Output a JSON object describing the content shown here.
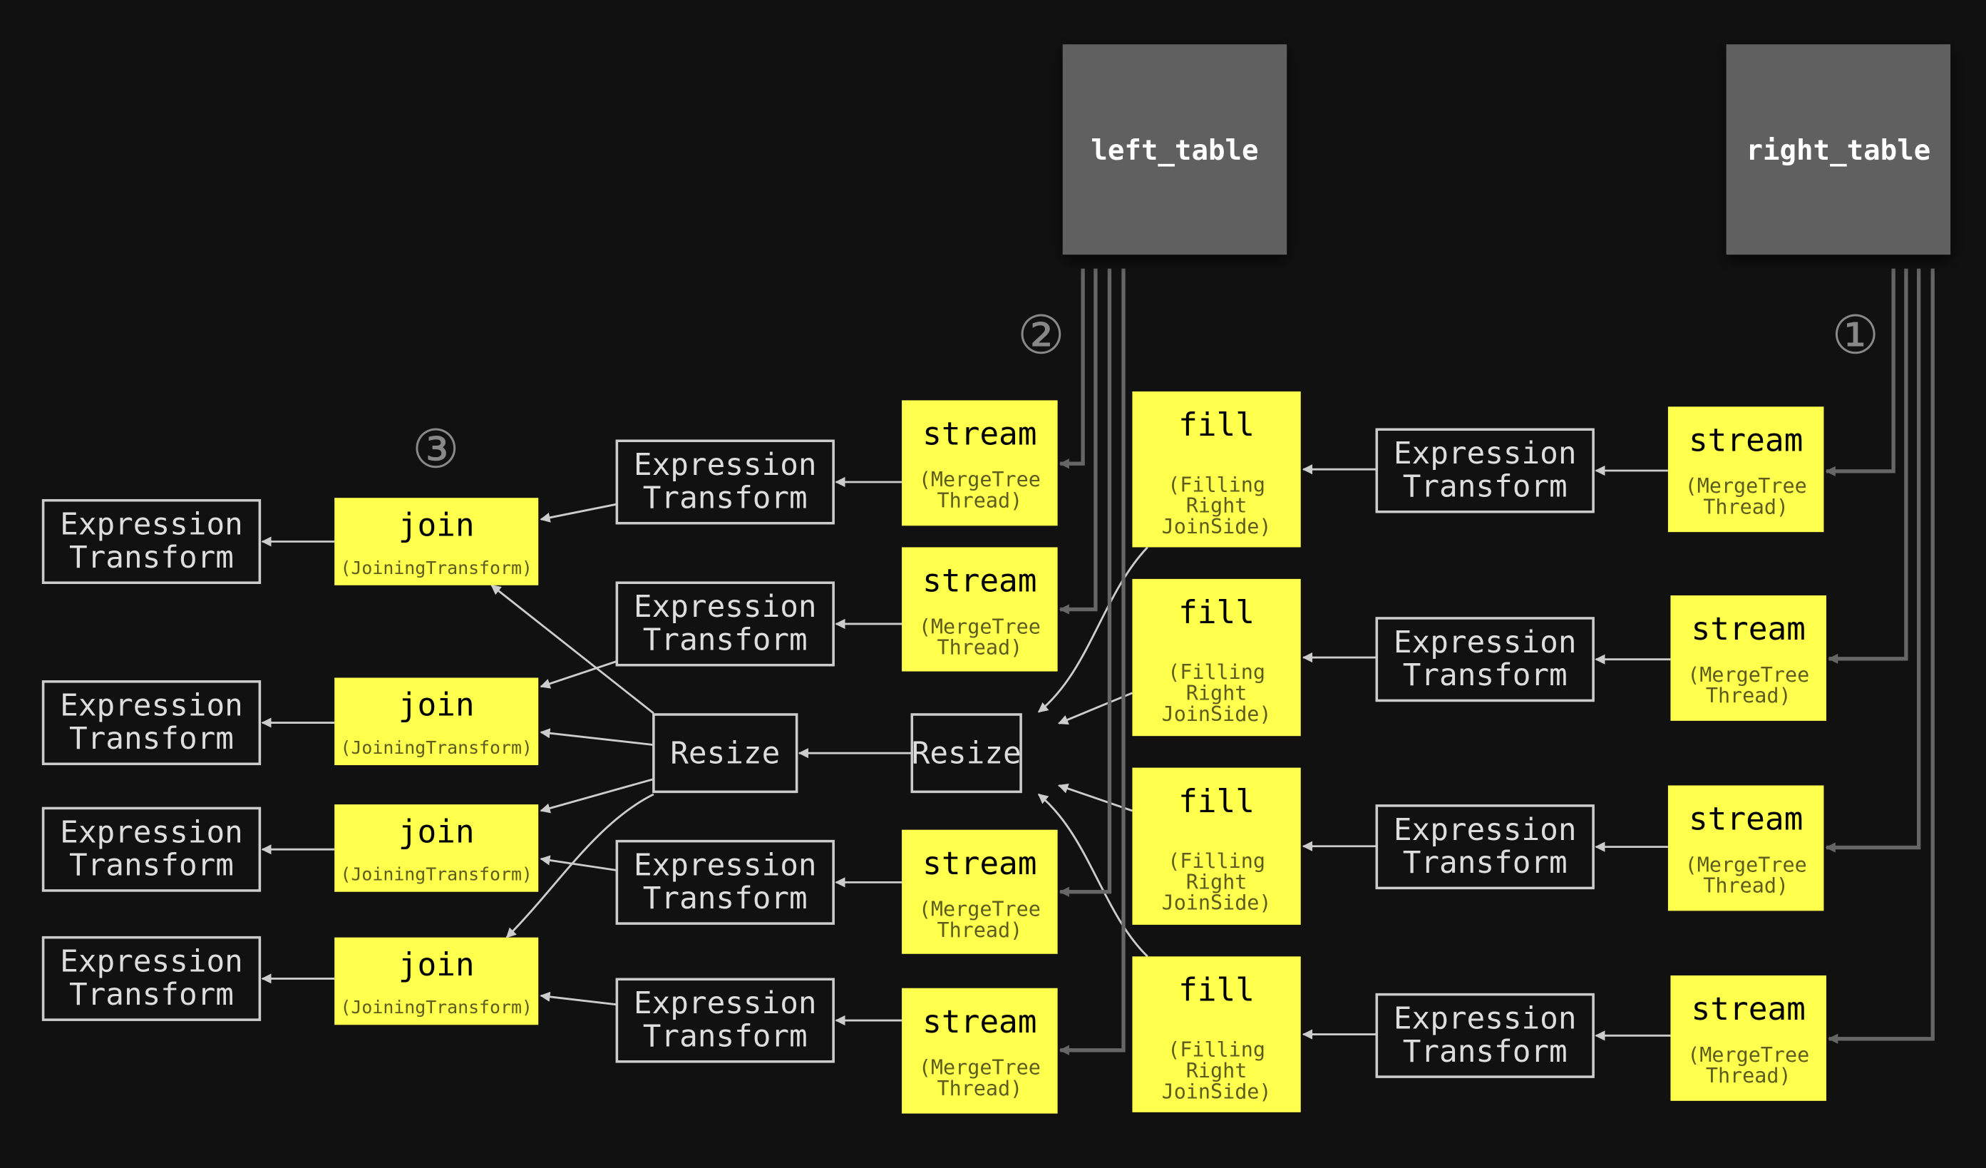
{
  "colors": {
    "background": "#111111",
    "table": "#606060",
    "processor": "#ffff4d",
    "edge": "#cccccc",
    "table_edge": "#666666"
  },
  "tables": [
    {
      "id": "lt",
      "label": "left_table"
    },
    {
      "id": "rt",
      "label": "right_table"
    }
  ],
  "markers": [
    {
      "id": "m2",
      "label": "②"
    },
    {
      "id": "m1",
      "label": "①"
    },
    {
      "id": "m3",
      "label": "③"
    }
  ],
  "nodes": [
    {
      "id": "rs1",
      "kind": "yellow",
      "title": "stream",
      "sub": [
        "(MergeTree",
        "Thread)"
      ]
    },
    {
      "id": "rs2",
      "kind": "yellow",
      "title": "stream",
      "sub": [
        "(MergeTree",
        "Thread)"
      ]
    },
    {
      "id": "rs3",
      "kind": "yellow",
      "title": "stream",
      "sub": [
        "(MergeTree",
        "Thread)"
      ]
    },
    {
      "id": "rs4",
      "kind": "yellow",
      "title": "stream",
      "sub": [
        "(MergeTree",
        "Thread)"
      ]
    },
    {
      "id": "re1",
      "kind": "box",
      "title": "Expression",
      "title2": "Transform"
    },
    {
      "id": "re2",
      "kind": "box",
      "title": "Expression",
      "title2": "Transform"
    },
    {
      "id": "re3",
      "kind": "box",
      "title": "Expression",
      "title2": "Transform"
    },
    {
      "id": "re4",
      "kind": "box",
      "title": "Expression",
      "title2": "Transform"
    },
    {
      "id": "f1",
      "kind": "yellow",
      "title": "fill",
      "sub": [
        "(Filling",
        "Right",
        "JoinSide)"
      ]
    },
    {
      "id": "f2",
      "kind": "yellow",
      "title": "fill",
      "sub": [
        "(Filling",
        "Right",
        "JoinSide)"
      ]
    },
    {
      "id": "f3",
      "kind": "yellow",
      "title": "fill",
      "sub": [
        "(Filling",
        "Right",
        "JoinSide)"
      ]
    },
    {
      "id": "f4",
      "kind": "yellow",
      "title": "fill",
      "sub": [
        "(Filling",
        "Right",
        "JoinSide)"
      ]
    },
    {
      "id": "rz2",
      "kind": "box",
      "title": "Resize"
    },
    {
      "id": "rz1",
      "kind": "box",
      "title": "Resize"
    },
    {
      "id": "ls1",
      "kind": "yellow",
      "title": "stream",
      "sub": [
        "(MergeTree",
        "Thread)"
      ]
    },
    {
      "id": "ls2",
      "kind": "yellow",
      "title": "stream",
      "sub": [
        "(MergeTree",
        "Thread)"
      ]
    },
    {
      "id": "ls3",
      "kind": "yellow",
      "title": "stream",
      "sub": [
        "(MergeTree",
        "Thread)"
      ]
    },
    {
      "id": "ls4",
      "kind": "yellow",
      "title": "stream",
      "sub": [
        "(MergeTree",
        "Thread)"
      ]
    },
    {
      "id": "me1",
      "kind": "box",
      "title": "Expression",
      "title2": "Transform"
    },
    {
      "id": "me2",
      "kind": "box",
      "title": "Expression",
      "title2": "Transform"
    },
    {
      "id": "me3",
      "kind": "box",
      "title": "Expression",
      "title2": "Transform"
    },
    {
      "id": "me4",
      "kind": "box",
      "title": "Expression",
      "title2": "Transform"
    },
    {
      "id": "j1",
      "kind": "yellow",
      "title": "join",
      "sub": [
        "(JoiningTransform)"
      ]
    },
    {
      "id": "j2",
      "kind": "yellow",
      "title": "join",
      "sub": [
        "(JoiningTransform)"
      ]
    },
    {
      "id": "j3",
      "kind": "yellow",
      "title": "join",
      "sub": [
        "(JoiningTransform)"
      ]
    },
    {
      "id": "j4",
      "kind": "yellow",
      "title": "join",
      "sub": [
        "(JoiningTransform)"
      ]
    },
    {
      "id": "le1",
      "kind": "box",
      "title": "Expression",
      "title2": "Transform"
    },
    {
      "id": "le2",
      "kind": "box",
      "title": "Expression",
      "title2": "Transform"
    },
    {
      "id": "le3",
      "kind": "box",
      "title": "Expression",
      "title2": "Transform"
    },
    {
      "id": "le4",
      "kind": "box",
      "title": "Expression",
      "title2": "Transform"
    }
  ],
  "edges": [
    [
      "rt",
      "rs1"
    ],
    [
      "rt",
      "rs2"
    ],
    [
      "rt",
      "rs3"
    ],
    [
      "rt",
      "rs4"
    ],
    [
      "rs1",
      "re1"
    ],
    [
      "rs2",
      "re2"
    ],
    [
      "rs3",
      "re3"
    ],
    [
      "rs4",
      "re4"
    ],
    [
      "re1",
      "f1"
    ],
    [
      "re2",
      "f2"
    ],
    [
      "re3",
      "f3"
    ],
    [
      "re4",
      "f4"
    ],
    [
      "f1",
      "rz2"
    ],
    [
      "f2",
      "rz2"
    ],
    [
      "f3",
      "rz2"
    ],
    [
      "f4",
      "rz2"
    ],
    [
      "rz2",
      "rz1"
    ],
    [
      "rz1",
      "j1"
    ],
    [
      "rz1",
      "j2"
    ],
    [
      "rz1",
      "j3"
    ],
    [
      "rz1",
      "j4"
    ],
    [
      "lt",
      "ls1"
    ],
    [
      "lt",
      "ls2"
    ],
    [
      "lt",
      "ls3"
    ],
    [
      "lt",
      "ls4"
    ],
    [
      "ls1",
      "me1"
    ],
    [
      "ls2",
      "me2"
    ],
    [
      "ls3",
      "me3"
    ],
    [
      "ls4",
      "me4"
    ],
    [
      "me1",
      "j1"
    ],
    [
      "me2",
      "j2"
    ],
    [
      "me3",
      "j3"
    ],
    [
      "me4",
      "j4"
    ],
    [
      "j1",
      "le1"
    ],
    [
      "j2",
      "le2"
    ],
    [
      "j3",
      "le3"
    ],
    [
      "j4",
      "le4"
    ]
  ]
}
